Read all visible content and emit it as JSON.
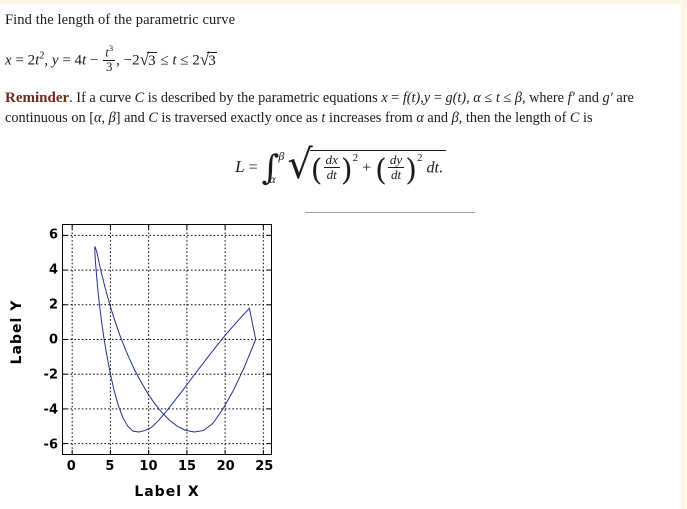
{
  "page": {
    "prompt": "Find the length of the parametric curve",
    "background_color": "#ffffff",
    "edge_color": "#fbf7e4"
  },
  "equation": {
    "x_lhs": "x",
    "x_rhs_coeff": "2",
    "x_rhs_var": "t",
    "x_rhs_power": "2",
    "y_lhs": "y",
    "y_rhs_coeff": "4",
    "y_rhs_var": "t",
    "minus": "−",
    "frac_num_var": "t",
    "frac_num_power": "3",
    "frac_den": "3",
    "domain_lower_coeff": "−2",
    "domain_radical": "√",
    "domain_radicand": "3",
    "domain_le": "≤",
    "domain_var": "t",
    "domain_upper_coeff": "2",
    "comma": ",",
    "equals": "="
  },
  "reminder": {
    "word": "Reminder",
    "period": ".",
    "text_1": " If a curve ",
    "curve_symbol": "C",
    "text_2": " is described by the parametric equations ",
    "eq_x": "x",
    "eq_f": "f",
    "eq_t1": "(t)",
    "eq_y": "y",
    "eq_g": "g",
    "eq_t2": "(t)",
    "alpha": "α",
    "beta": "β",
    "le": "≤",
    "t": "t",
    "text_3": ", where ",
    "fprime": "f′",
    "text_4": " and ",
    "gprime": "g′",
    "text_5": " are continuous on [",
    "text_6": "] and ",
    "text_7": " is traversed exactly once as ",
    "text_8": " increases from ",
    "text_9": " and ",
    "text_10": ", then the length of ",
    "text_11": " is"
  },
  "integral": {
    "L": "L",
    "equals": "=",
    "symbol": "∫",
    "upper_limit": "β",
    "lower_limit": "α",
    "radical": "√",
    "dx": "dx",
    "dt1": "dt",
    "power_a": "2",
    "plus": "+",
    "dy": "dy",
    "dt2": "dt",
    "power_b": "2",
    "differential": "dt",
    "period": "."
  },
  "chart_data": {
    "type": "line",
    "title": "",
    "xlabel": "Label X",
    "ylabel": "Label Y",
    "xlim": [
      -1.2,
      26.0
    ],
    "ylim": [
      -6.6,
      6.6
    ],
    "xticks": [
      0,
      5,
      10,
      15,
      20,
      25
    ],
    "yticks": [
      -6,
      -4,
      -2,
      0,
      2,
      4,
      6
    ],
    "grid": true,
    "grid_style": "dotted",
    "grid_color": "#000000",
    "legend": "none",
    "series": [
      {
        "name": "x = 2t^2, y = 4t - t^3/3",
        "color": "#1f2f8f",
        "linewidth": 1,
        "param_t_min": -3.4641,
        "param_t_max": 3.4641,
        "x": [
          24.0,
          22.52,
          21.1,
          19.73,
          18.41,
          17.15,
          15.94,
          14.79,
          13.69,
          12.64,
          11.65,
          10.71,
          9.83,
          9.0,
          8.22,
          7.5,
          6.83,
          6.21,
          5.65,
          5.14,
          4.69,
          4.29,
          3.94,
          3.64,
          3.4,
          3.21,
          3.07,
          2.99,
          2.95,
          2.97,
          3.04,
          3.17,
          3.34,
          3.57,
          3.85,
          4.18,
          4.57,
          5.0,
          5.49,
          6.03,
          6.62,
          7.27,
          7.96,
          8.71,
          9.51,
          10.36,
          11.27,
          12.22,
          13.23,
          14.29,
          15.4,
          16.57,
          17.79,
          19.05,
          20.37,
          21.75,
          23.17,
          24.0
        ],
        "y": [
          0.0,
          -1.59,
          -2.92,
          -3.99,
          -4.83,
          -5.25,
          -5.33,
          -5.23,
          -4.98,
          -4.62,
          -4.17,
          -3.65,
          -3.07,
          -2.45,
          -1.8,
          -1.12,
          -0.43,
          0.28,
          0.99,
          1.69,
          2.37,
          3.02,
          3.63,
          4.19,
          4.68,
          5.07,
          5.25,
          5.33,
          5.28,
          5.0,
          4.5,
          3.8,
          2.95,
          2.0,
          1.0,
          0.0,
          -1.0,
          -2.0,
          -2.95,
          -3.8,
          -4.5,
          -5.0,
          -5.28,
          -5.33,
          -5.25,
          -5.07,
          -4.68,
          -4.19,
          -3.63,
          -3.02,
          -2.37,
          -1.69,
          -0.99,
          -0.28,
          0.43,
          1.12,
          1.8,
          0.0
        ]
      }
    ],
    "annotations": {
      "cusp_point": [
        24,
        0
      ],
      "ymax_value": 5.33,
      "ymin_value": -5.33,
      "xmin_value": 0
    }
  }
}
